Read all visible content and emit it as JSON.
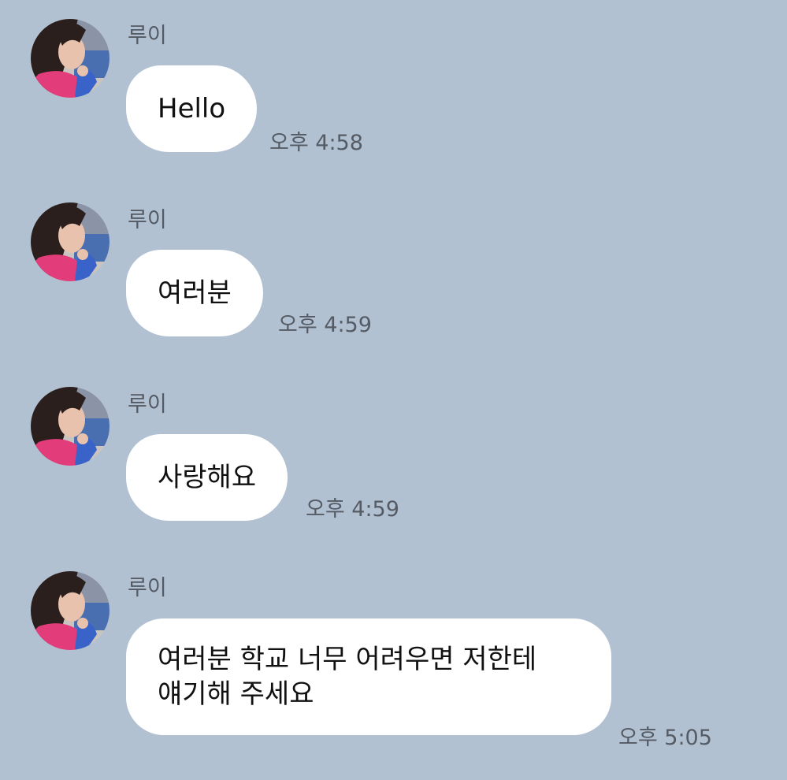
{
  "messages": [
    {
      "sender": "루이",
      "lines": [
        "Hello"
      ],
      "time": "오후 4:58"
    },
    {
      "sender": "루이",
      "lines": [
        "여러분"
      ],
      "time": "오후 4:59"
    },
    {
      "sender": "루이",
      "lines": [
        "사랑해요"
      ],
      "time": "오후 4:59"
    },
    {
      "sender": "루이",
      "lines": [
        "여러분 학교 너무 어려우면 저한테",
        "얘기해 주세요"
      ],
      "time": "오후 5:05"
    }
  ],
  "colors": {
    "background": "#b2c1d2",
    "bubble": "#ffffff",
    "meta_text": "#555b64"
  },
  "icons": {
    "avatar": "profile-photo"
  }
}
